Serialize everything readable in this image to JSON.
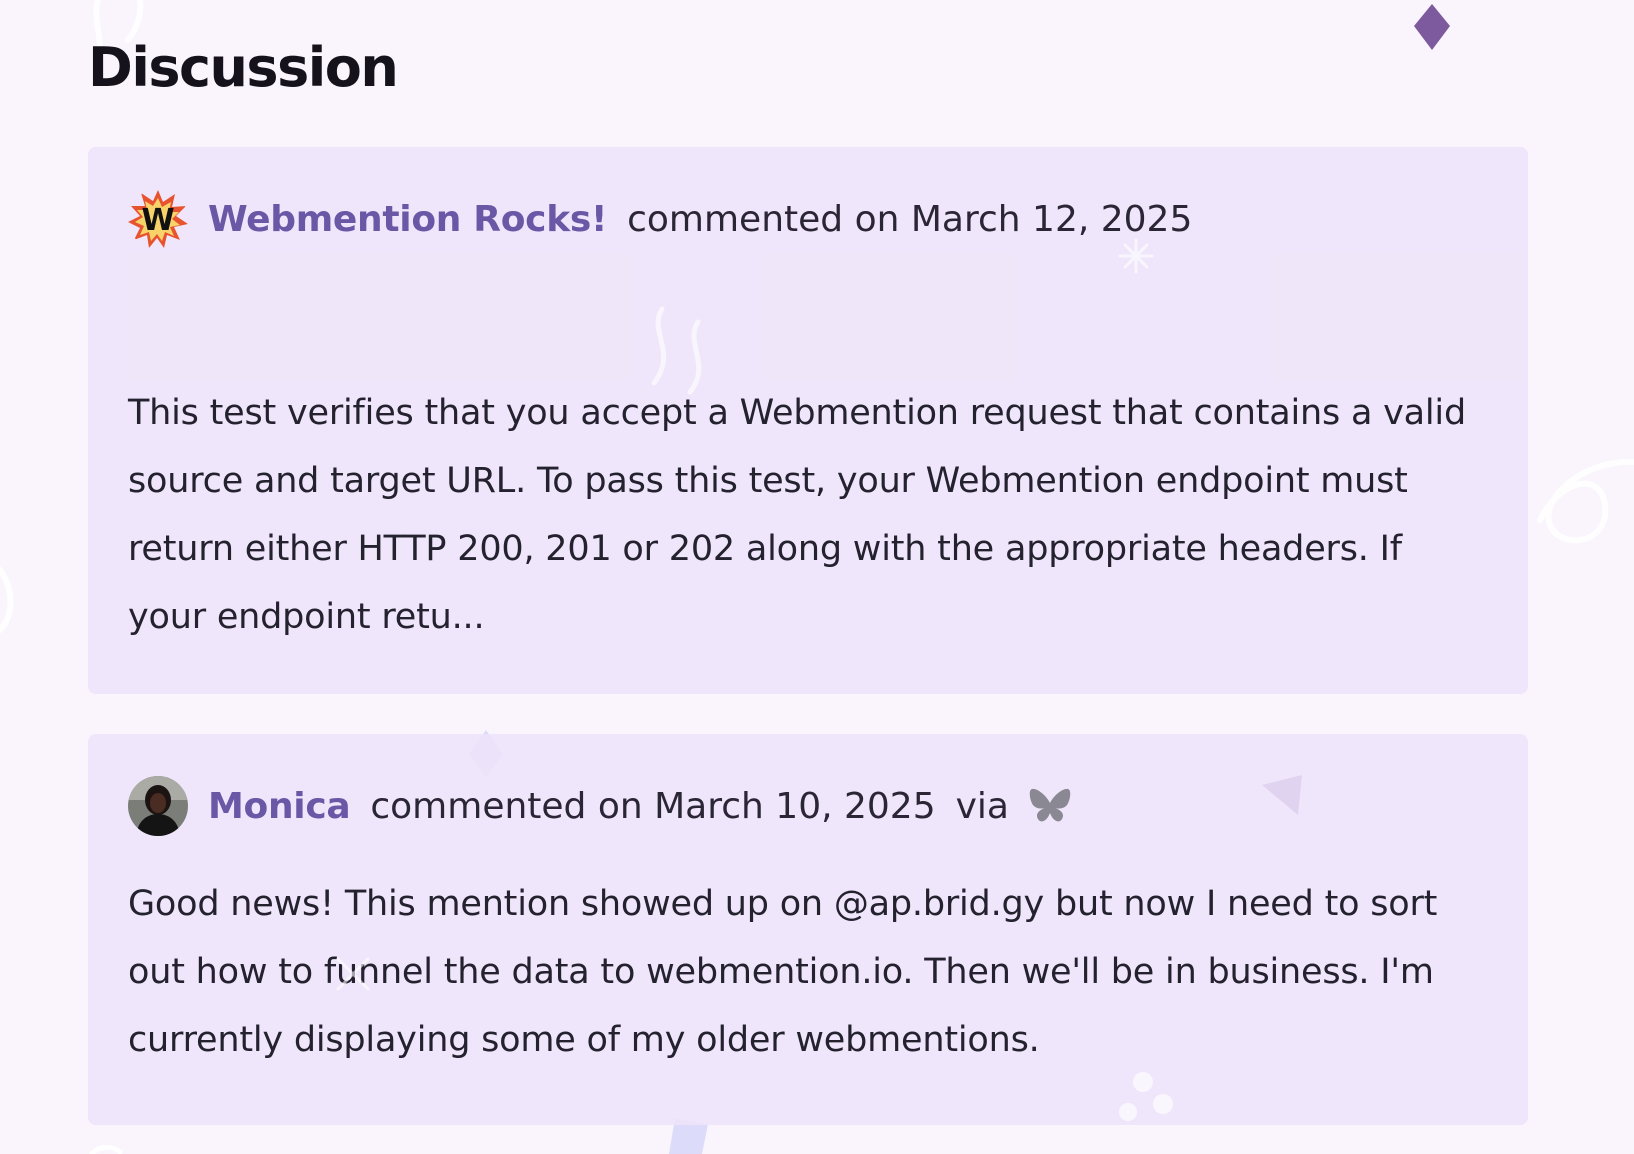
{
  "section": {
    "title": "Discussion"
  },
  "comments": [
    {
      "author": "Webmention Rocks!",
      "action": "commented on March 12, 2025",
      "avatar_icon": "webmention-rocks-logo",
      "body": "This test verifies that you accept a Webmention request that contains a valid source and target URL. To pass this test, your Webmention endpoint must return either HTTP 200, 201 or 202 along with the appropriate headers. If your endpoint retu..."
    },
    {
      "author": "Monica",
      "action": "commented on March 10, 2025",
      "via": "via",
      "source_icon": "bluesky-butterfly-icon",
      "avatar_icon": "user-photo",
      "body": "Good news! This mention showed up on @ap.brid.gy but now I need to sort out how to funnel the data to webmention.io. Then we'll be in business. I'm currently displaying some of my older webmentions."
    }
  ],
  "colors": {
    "background": "#faf4fc",
    "card": "#efe6fb",
    "author_link": "#6a57a6",
    "text": "#2b2636",
    "confetti_purple": "#7d5a9e",
    "confetti_lavender": "#dcdcfa"
  }
}
